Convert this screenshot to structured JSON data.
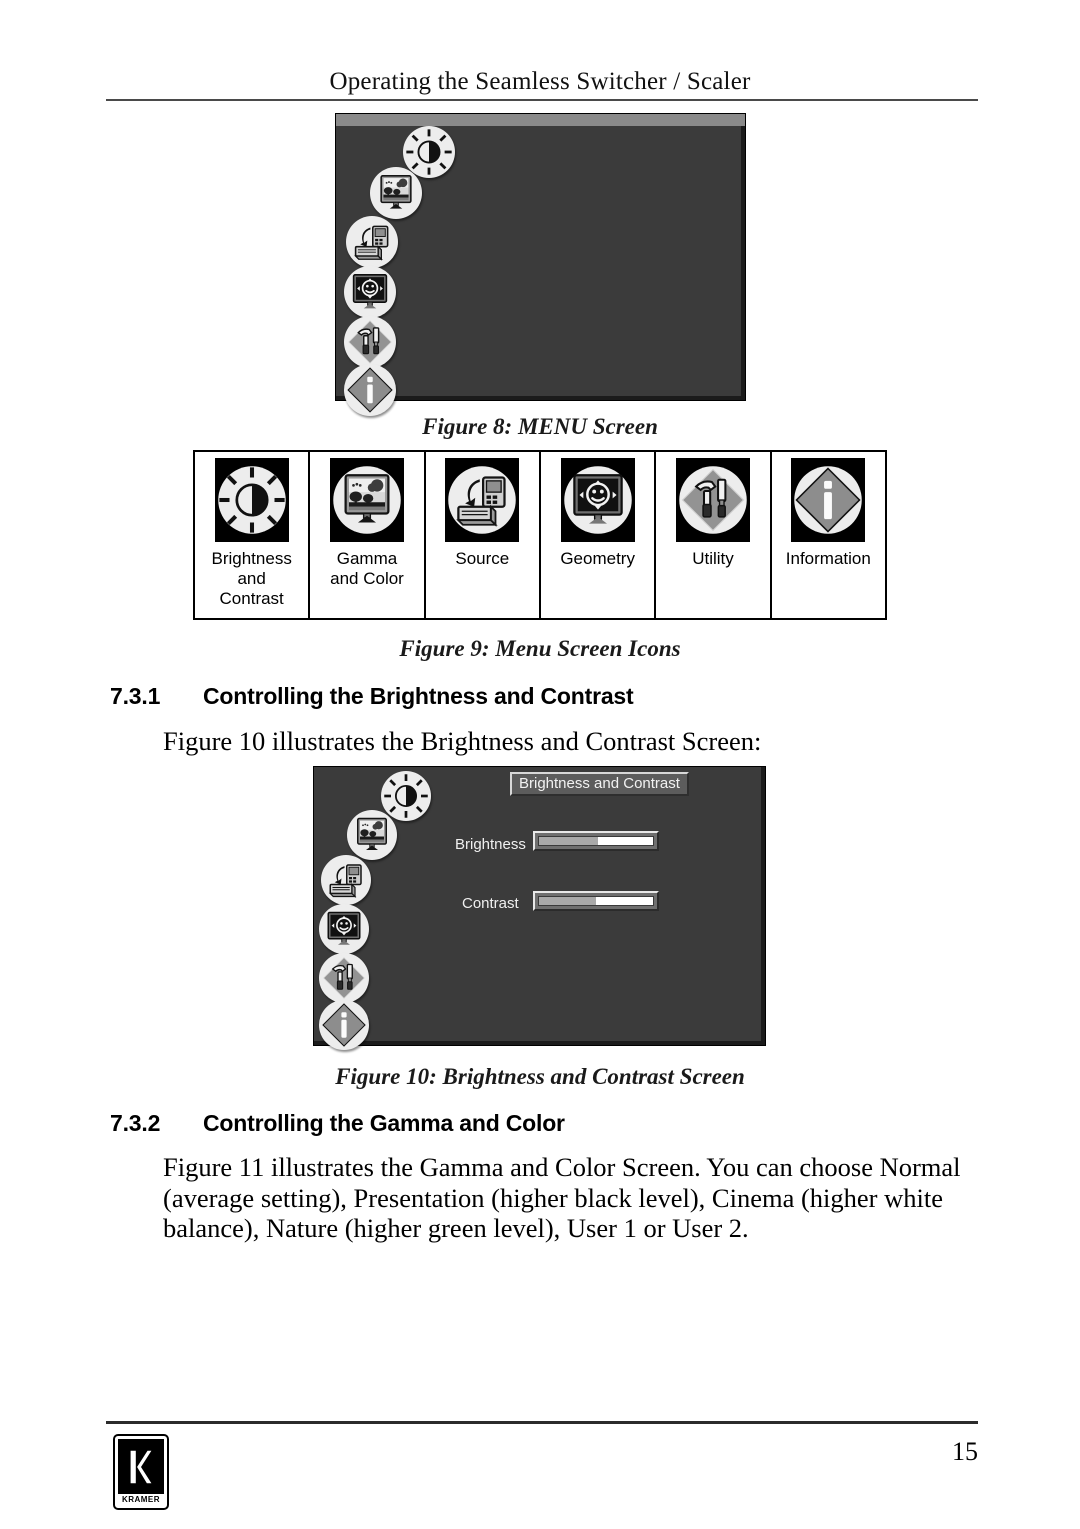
{
  "header": {
    "running_title": "Operating the Seamless Switcher / Scaler"
  },
  "figure8": {
    "caption": "Figure 8: MENU Screen",
    "icons": [
      {
        "name": "brightness-contrast-icon",
        "label": "Brightness and Contrast"
      },
      {
        "name": "gamma-color-icon",
        "label": "Gamma and Color"
      },
      {
        "name": "source-icon",
        "label": "Source"
      },
      {
        "name": "geometry-icon",
        "label": "Geometry"
      },
      {
        "name": "utility-icon",
        "label": "Utility"
      },
      {
        "name": "information-icon",
        "label": "Information"
      }
    ]
  },
  "figure9": {
    "caption": "Figure 9: Menu Screen Icons",
    "cells": [
      {
        "icon": "brightness-contrast-icon",
        "label": "Brightness\nand\nContrast"
      },
      {
        "icon": "gamma-color-icon",
        "label": "Gamma\nand Color"
      },
      {
        "icon": "source-icon",
        "label": "Source"
      },
      {
        "icon": "geometry-icon",
        "label": "Geometry"
      },
      {
        "icon": "utility-icon",
        "label": "Utility"
      },
      {
        "icon": "information-icon",
        "label": "Information"
      }
    ]
  },
  "section_731": {
    "number": "7.3.1",
    "title": "Controlling the Brightness and Contrast",
    "paragraph": "Figure 10 illustrates the Brightness and Contrast Screen:"
  },
  "figure10": {
    "caption": "Figure 10: Brightness and Contrast Screen",
    "window_title": "Brightness and Contrast",
    "fields": [
      {
        "label": "Brightness",
        "fill_percent": 52
      },
      {
        "label": "Contrast",
        "fill_percent": 50
      }
    ]
  },
  "section_732": {
    "number": "7.3.2",
    "title": "Controlling the Gamma and Color",
    "paragraph": "Figure 11 illustrates the Gamma and Color Screen. You can choose Normal (average setting), Presentation (higher black level), Cinema (higher white balance), Nature (higher green level), User 1 or User 2."
  },
  "footer": {
    "logo_wordmark": "KRAMER",
    "page_number": "15"
  }
}
